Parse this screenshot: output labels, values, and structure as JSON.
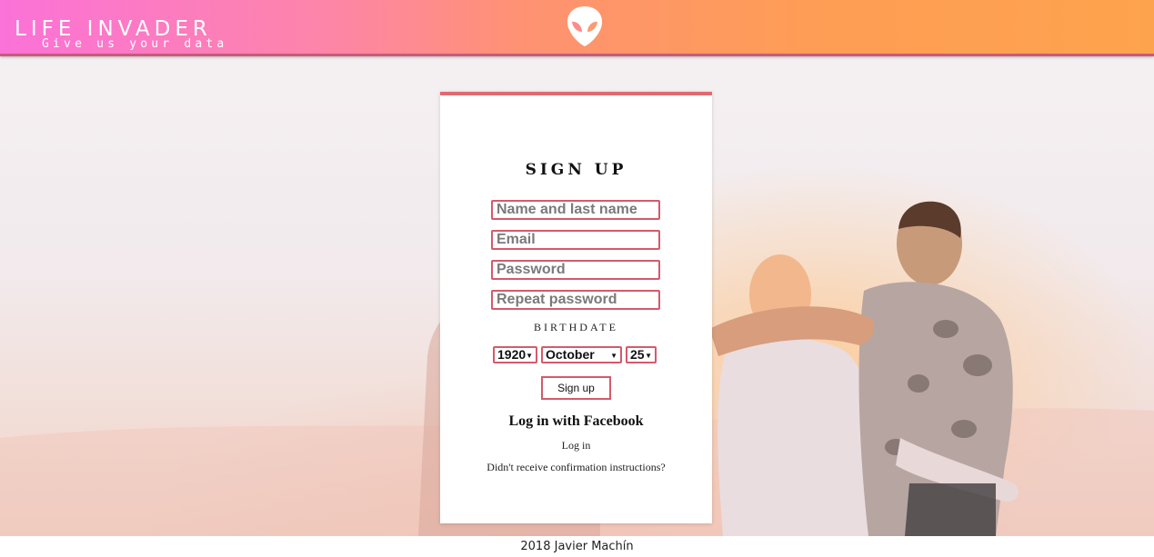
{
  "header": {
    "title": "LIFE INVADER",
    "tagline": "Give us your data",
    "logo_icon": "alien-head-icon"
  },
  "colors": {
    "header_gradient_start": "#fb72d8",
    "header_gradient_end": "#fea34d",
    "accent": "#d55a6a",
    "card_top_border": "#e06a70"
  },
  "signup": {
    "title": "SIGN UP",
    "name_placeholder": "Name and last name",
    "email_placeholder": "Email",
    "password_placeholder": "Password",
    "repeat_password_placeholder": "Repeat password",
    "birthdate_label": "BIRTHDATE",
    "birth_year": "1920",
    "birth_month": "October",
    "birth_day": "25",
    "submit_label": "Sign up",
    "facebook_label": "Log in with Facebook",
    "login_label": "Log in",
    "confirmation_label": "Didn't receive confirmation instructions?"
  },
  "footer": {
    "text": "2018 Javier Machín"
  }
}
